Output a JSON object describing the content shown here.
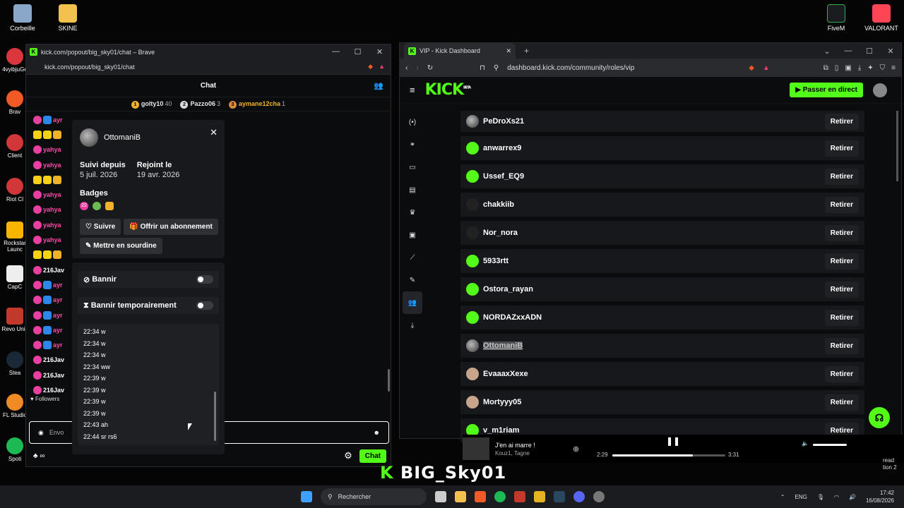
{
  "desktop": {
    "icons": [
      {
        "label": "Corbeille"
      },
      {
        "label": "SKINE"
      },
      {
        "label": "FiveM"
      },
      {
        "label": "VALORANT"
      }
    ],
    "strip": [
      {
        "label": "4vyibjuGe"
      },
      {
        "label": "Brav"
      },
      {
        "label": "Client"
      },
      {
        "label": "Riot Cl"
      },
      {
        "label": "Rockstar Launc"
      },
      {
        "label": "CapC"
      },
      {
        "label": "Revo Unis"
      },
      {
        "label": "Stea"
      },
      {
        "label": "FL Studio"
      },
      {
        "label": "Spoti"
      }
    ]
  },
  "chat_window": {
    "title": "kick.com/popout/big_sky01/chat – Brave",
    "url": "kick.com/popout/big_sky01/chat",
    "header_title": "Chat",
    "top_gifters": [
      {
        "rank": "1",
        "name": "golty10",
        "count": "40",
        "color": "#f0b22a"
      },
      {
        "rank": "2",
        "name": "Pazzo06",
        "count": "3",
        "color": "#d9d9d9"
      },
      {
        "rank": "3",
        "name": "aymane12cha",
        "count": "1",
        "color": "#d98a3a"
      }
    ],
    "messages": [
      {
        "name": "ayr",
        "style": "pink",
        "badges": [
          "pink",
          "blue"
        ]
      },
      {
        "name": "",
        "style": "pink",
        "badges": [
          "yel",
          "yel",
          "gold"
        ]
      },
      {
        "name": "yahya",
        "style": "pink",
        "badges": [
          "pink"
        ]
      },
      {
        "name": "yahya",
        "style": "pink",
        "badges": [
          "pink"
        ]
      },
      {
        "name": "",
        "style": "pink",
        "badges": [
          "yel",
          "yel",
          "gold"
        ]
      },
      {
        "name": "yahya",
        "style": "pink",
        "badges": [
          "pink"
        ]
      },
      {
        "name": "yahya",
        "style": "pink",
        "badges": [
          "pink"
        ]
      },
      {
        "name": "yahya",
        "style": "pink",
        "badges": [
          "pink"
        ]
      },
      {
        "name": "yahya",
        "style": "pink",
        "badges": [
          "pink"
        ]
      },
      {
        "name": "",
        "style": "pink",
        "badges": [
          "yel",
          "yel",
          "gold"
        ]
      },
      {
        "name": "216Jav",
        "style": "white",
        "badges": [
          "pink"
        ]
      },
      {
        "name": "ayr",
        "style": "pink",
        "badges": [
          "pink",
          "blue"
        ]
      },
      {
        "name": "ayr",
        "style": "pink",
        "badges": [
          "pink",
          "blue"
        ]
      },
      {
        "name": "ayr",
        "style": "pink",
        "badges": [
          "pink",
          "blue"
        ]
      },
      {
        "name": "ayr",
        "style": "pink",
        "badges": [
          "pink",
          "blue"
        ]
      },
      {
        "name": "ayr",
        "style": "pink",
        "badges": [
          "pink",
          "blue"
        ]
      },
      {
        "name": "216Jav",
        "style": "white",
        "badges": [
          "pink"
        ]
      },
      {
        "name": "216Jav",
        "style": "white",
        "badges": [
          "pink"
        ]
      },
      {
        "name": "216Jav",
        "style": "white",
        "badges": [
          "pink"
        ]
      }
    ],
    "followers_label": "Followers",
    "input_placeholder": "Envo",
    "chat_button": "Chat"
  },
  "user_card": {
    "username": "OttomaniB",
    "followed_label": "Suivi depuis",
    "followed_value": "5 juil. 2026",
    "joined_label": "Rejoint le",
    "joined_value": "19 avr. 2026",
    "badges_label": "Badges",
    "badge_22": "22",
    "follow_button": "Suivre",
    "gift_button": "Offrir un abonnement",
    "mute_button": "Mettre en sourdine"
  },
  "mod_panel": {
    "ban_label": "Bannir",
    "timeout_label": "Bannir temporairement",
    "history": [
      "22:34 w",
      "22:34 w",
      "22:34 w",
      "22:34 ww",
      "22:39 w",
      "22:39 w",
      "22:39 w",
      "22:39 w",
      "22:43 ah",
      "22:44 sr rs6"
    ]
  },
  "dashboard_window": {
    "tab_title": "VIP - Kick Dashboard",
    "url": "dashboard.kick.com/community/roles/vip",
    "logo": "KICK",
    "logo_sup": "BETA",
    "live_button": "Passer en direct",
    "remove_label": "Retirer",
    "vips": [
      {
        "name": "PeDroXs21",
        "avatar": "grey"
      },
      {
        "name": "anwarrex9",
        "avatar": "green"
      },
      {
        "name": "Ussef_EQ9",
        "avatar": "green"
      },
      {
        "name": "chakkiib",
        "avatar": "dark"
      },
      {
        "name": "Nor_nora",
        "avatar": "dark"
      },
      {
        "name": "5933rtt",
        "avatar": "green"
      },
      {
        "name": "Ostora_rayan",
        "avatar": "green"
      },
      {
        "name": "NORDAZxxADN",
        "avatar": "green"
      },
      {
        "name": "OttomaniB",
        "avatar": "grey",
        "highlight": true
      },
      {
        "name": "EvaaaxXexe",
        "avatar": "skin"
      },
      {
        "name": "Mortyyy05",
        "avatar": "skin"
      },
      {
        "name": "v_m1riam",
        "avatar": "green"
      }
    ]
  },
  "spotify": {
    "title": "J'en ai marre !",
    "artist": "Kouz1, Tagne",
    "elapsed": "2:29",
    "duration": "3:31",
    "progress": 0.71
  },
  "overlay": {
    "stream_tag": "BIG_Sky01",
    "side_texts": [
      "read",
      "tion 2"
    ]
  },
  "taskbar": {
    "search_label": "Rechercher",
    "lang": "ENG",
    "time": "17:42",
    "date": "16/08/2026"
  }
}
